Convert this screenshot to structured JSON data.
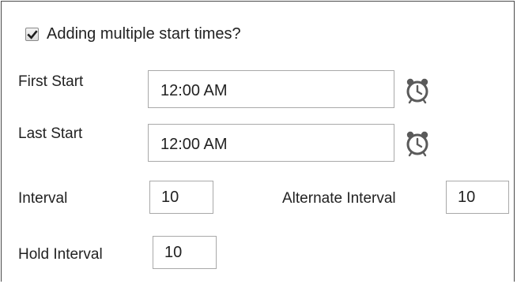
{
  "multiple_start": {
    "checked": true,
    "label": "Adding multiple start times?"
  },
  "first_start": {
    "label": "First Start",
    "value": "12:00 AM",
    "icon": "alarm-clock-icon"
  },
  "last_start": {
    "label": "Last Start",
    "value": "12:00 AM",
    "icon": "alarm-clock-icon"
  },
  "interval": {
    "label": "Interval",
    "value": "10"
  },
  "alternate_interval": {
    "label": "Alternate Interval",
    "value": "10"
  },
  "hold_interval": {
    "label": "Hold Interval",
    "value": "10"
  },
  "colors": {
    "border": "#a9a9a9",
    "text": "#222222",
    "icon": "#5a5a5a"
  }
}
